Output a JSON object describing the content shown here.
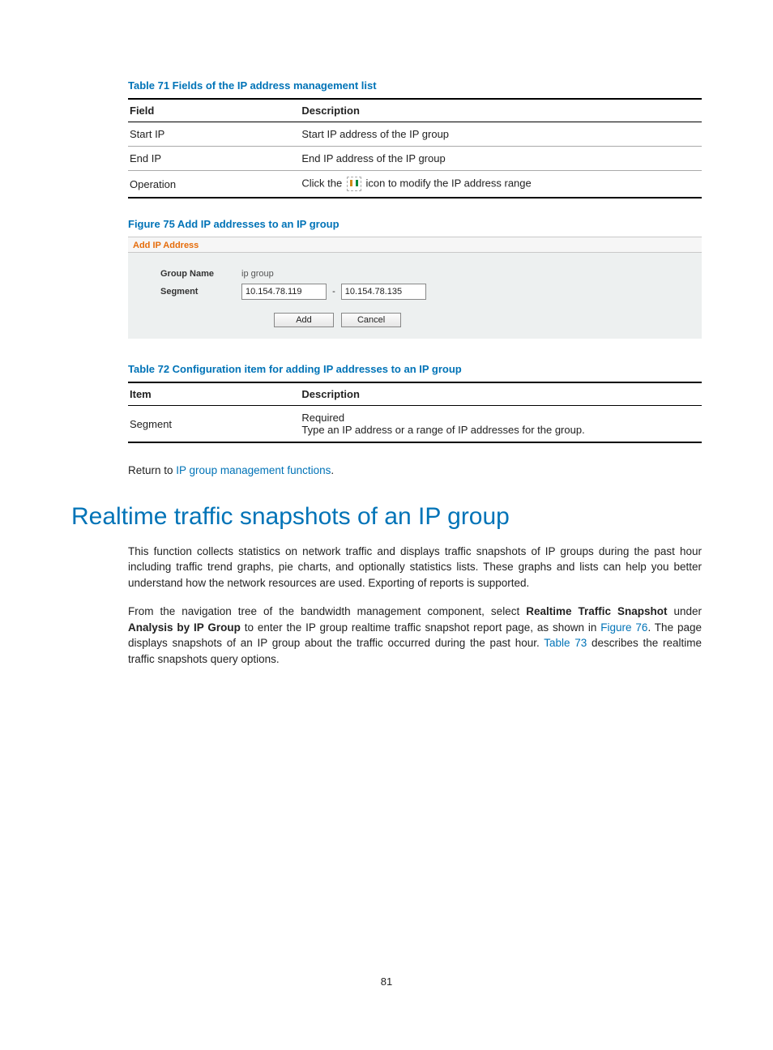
{
  "table71": {
    "caption": "Table 71 Fields of the IP address management list",
    "headers": {
      "field": "Field",
      "description": "Description"
    },
    "rows": [
      {
        "field": "Start IP",
        "desc": "Start IP address of the IP group"
      },
      {
        "field": "End IP",
        "desc": "End IP address of the IP group"
      },
      {
        "field": "Operation",
        "desc_pre": "Click the ",
        "desc_post": " icon to modify the IP address range"
      }
    ]
  },
  "figure75": {
    "caption": "Figure 75 Add IP addresses to an IP group",
    "panel_title": "Add IP Address",
    "group_name_label": "Group Name",
    "group_name_value": "ip group",
    "segment_label": "Segment",
    "segment_start": "10.154.78.119",
    "segment_sep": "-",
    "segment_end": "10.154.78.135",
    "btn_add": "Add",
    "btn_cancel": "Cancel"
  },
  "table72": {
    "caption": "Table 72 Configuration item for adding IP addresses to an IP group",
    "headers": {
      "item": "Item",
      "description": "Description"
    },
    "row": {
      "item": "Segment",
      "line1": "Required",
      "line2": "Type an IP address or a range of IP addresses for the group."
    }
  },
  "return_text": {
    "pre": "Return to ",
    "link": "IP group management functions",
    "post": "."
  },
  "section_heading": "Realtime traffic snapshots of an IP group",
  "para1": "This function collects statistics on network traffic and displays traffic snapshots of IP groups during the past hour including traffic trend graphs, pie charts, and optionally statistics lists. These graphs and lists can help you better understand how the network resources are used. Exporting of reports is supported.",
  "para2": {
    "t1": "From the navigation tree of the bandwidth management component, select ",
    "b1": "Realtime Traffic Snapshot",
    "t2": " under ",
    "b2": "Analysis by IP Group",
    "t3": " to enter the IP group realtime traffic snapshot report page, as shown in ",
    "link1": "Figure 76",
    "t4": ". The page displays snapshots of an IP group about the traffic occurred during the past hour. ",
    "link2": "Table 73",
    "t5": " describes the realtime traffic snapshots query options."
  },
  "page_number": "81"
}
